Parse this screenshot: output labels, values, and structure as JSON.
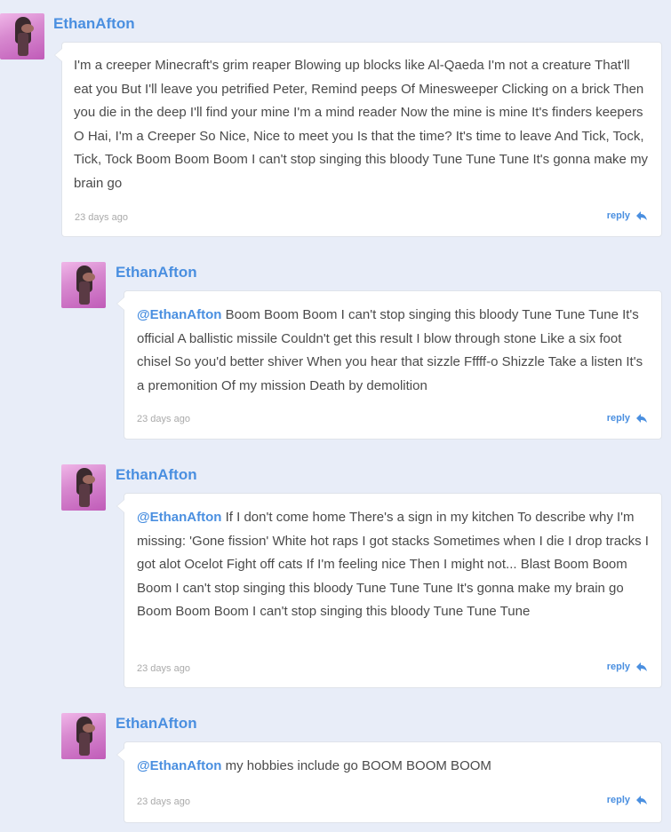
{
  "comments": [
    {
      "author": "EthanAfton",
      "mention": "",
      "text": "I'm a creeper Minecraft's grim reaper Blowing up blocks like Al-Qaeda I'm not a creature That'll eat you But I'll leave you petrified Peter, Remind peeps Of Minesweeper Clicking on a brick Then you die in the deep I'll find your mine I'm a mind reader Now the mine is mine It's finders keepers O Hai, I'm a Creeper So Nice, Nice to meet you Is that the time? It's time to leave And Tick, Tock, Tick, Tock Boom Boom Boom I can't stop singing this bloody Tune Tune Tune It's gonna make my brain go",
      "time": "23 days ago",
      "reply_label": "reply"
    },
    {
      "author": "EthanAfton",
      "mention": "@EthanAfton",
      "text": "Boom Boom Boom I can't stop singing this bloody Tune Tune Tune It's official A ballistic missile Couldn't get this result I blow through stone Like a six foot chisel So you'd better shiver When you hear that sizzle Fffff-o Shizzle Take a listen It's a premonition Of my mission Death by demolition",
      "time": "23 days ago",
      "reply_label": "reply"
    },
    {
      "author": "EthanAfton",
      "mention": "@EthanAfton",
      "text": "If I don't come home There's a sign in my kitchen To describe why I'm missing: 'Gone fission' White hot raps I got stacks Sometimes when I die I drop tracks I got alot Ocelot Fight off cats If I'm feeling nice Then I might not... Blast Boom Boom Boom I can't stop singing this bloody Tune Tune Tune It's gonna make my brain go Boom Boom Boom I can't stop singing this bloody Tune Tune Tune",
      "time": "23 days ago",
      "reply_label": "reply"
    },
    {
      "author": "EthanAfton",
      "mention": "@EthanAfton",
      "text": "my hobbies include go BOOM BOOM BOOM",
      "time": "23 days ago",
      "reply_label": "reply"
    }
  ],
  "colors": {
    "background": "#e8edf8",
    "link": "#4a8fe0",
    "text": "#4a4a4a",
    "muted": "#aaaaaa"
  },
  "icons": {
    "avatar": "avatar-image",
    "reply": "reply-arrow-icon"
  }
}
